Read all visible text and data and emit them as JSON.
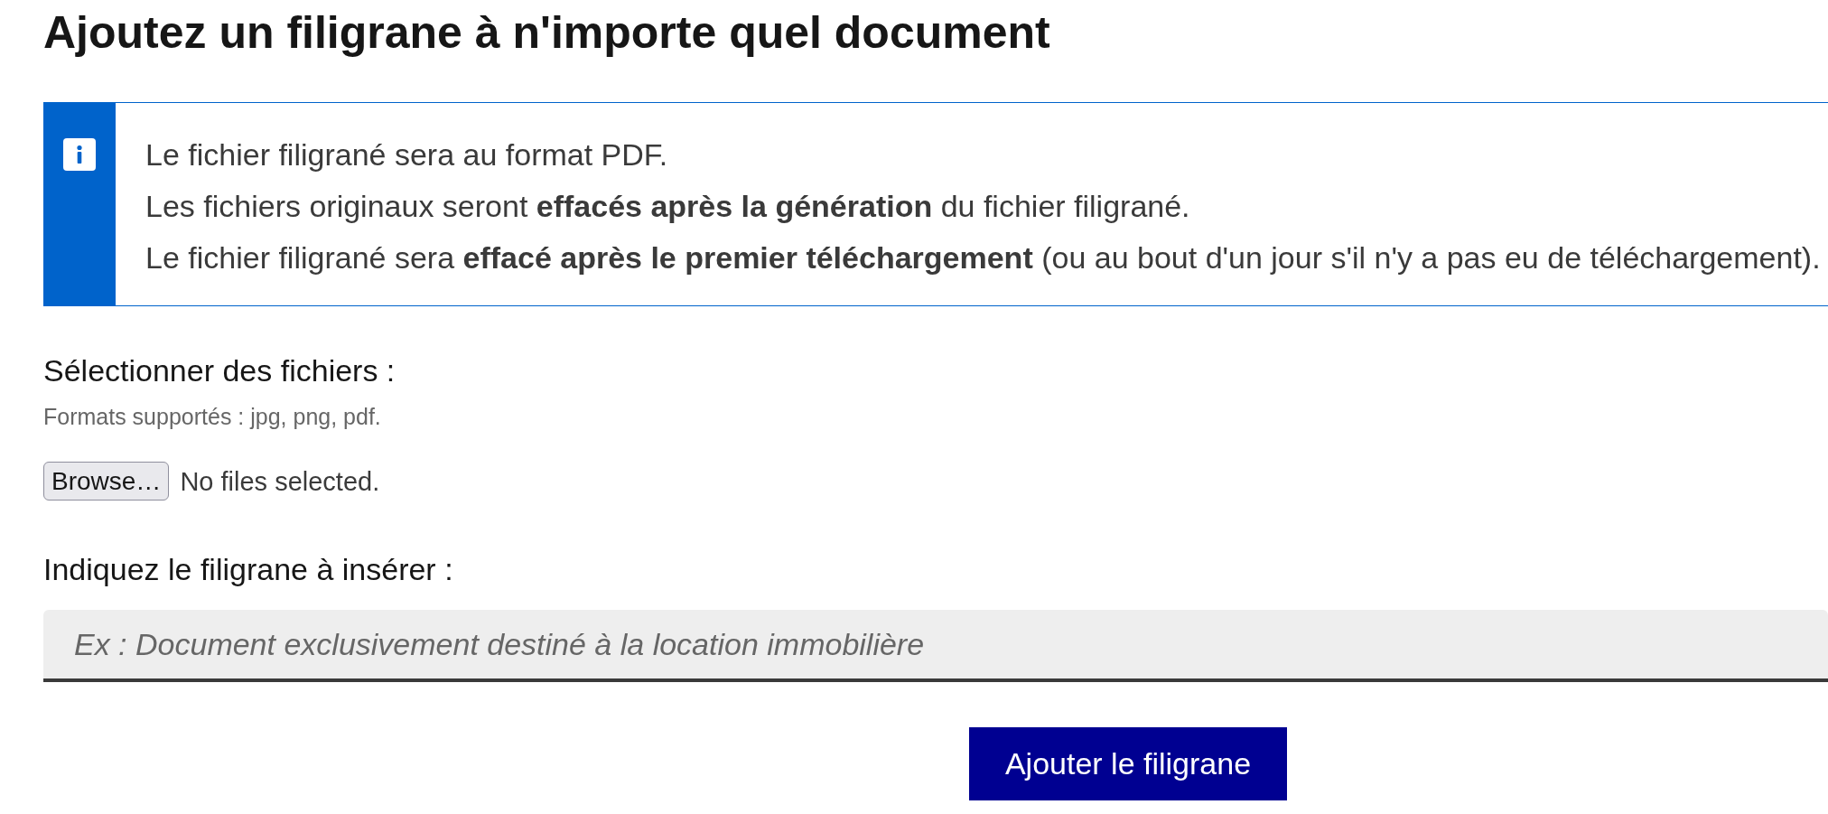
{
  "page": {
    "title": "Ajoutez un filigrane à n'importe quel document"
  },
  "notice": {
    "lines": [
      "Le fichier filigrané sera au format PDF.",
      "Les fichiers originaux seront **effacés après la génération** du fichier filigrané.",
      "Le fichier filigrané sera **effacé après le premier téléchargement** (ou au bout d'un jour s'il n'y a pas eu de téléchargement)."
    ]
  },
  "file_upload": {
    "label": "Sélectionner des fichiers :",
    "hint": "Formats supportés : jpg, png, pdf.",
    "button": "Browse…",
    "status": "No files selected."
  },
  "watermark_field": {
    "label": "Indiquez le filigrane à insérer :",
    "placeholder": "Ex : Document exclusivement destiné à la location immobilière"
  },
  "submit_button": "Ajouter le filigrane"
}
